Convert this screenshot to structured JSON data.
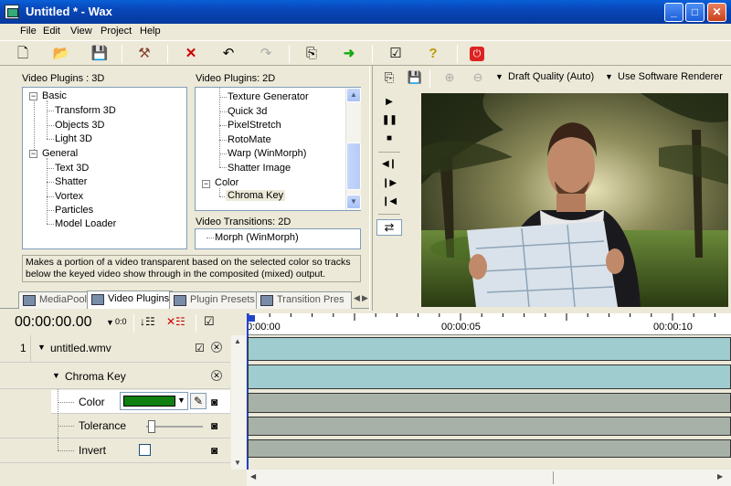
{
  "window": {
    "title": "Untitled * - Wax",
    "min": "_",
    "max": "□",
    "close": "✕"
  },
  "menu": [
    "File",
    "Edit",
    "View",
    "Project",
    "Help"
  ],
  "toolbar_icons": [
    "new-file",
    "open-folder",
    "save",
    "build",
    "delete",
    "undo",
    "redo",
    "export",
    "go-arrow",
    "properties",
    "help",
    "exit"
  ],
  "plugins3d": {
    "label": "Video Plugins : 3D",
    "groups": [
      {
        "name": "Basic",
        "items": [
          "Transform 3D",
          "Objects 3D",
          "Light 3D"
        ]
      },
      {
        "name": "General",
        "items": [
          "Text 3D",
          "Shatter",
          "Vortex",
          "Particles",
          "Model Loader"
        ]
      }
    ]
  },
  "plugins2d": {
    "label": "Video Plugins: 2D",
    "items": [
      "Texture Generator",
      "Quick 3d",
      "PixelStretch",
      "RotoMate",
      "Warp (WinMorph)",
      "Shatter Image"
    ],
    "group": "Color",
    "group_items": [
      "Chroma Key"
    ]
  },
  "transitions": {
    "label": "Video Transitions: 2D",
    "items": [
      "Morph (WinMorph)"
    ]
  },
  "description": "Makes a portion of a video transparent based on the selected color so tracks below the keyed video show through in the composited (mixed) output.",
  "tabs": [
    "MediaPool",
    "Video Plugins",
    "Plugin Presets",
    "Transition Pres"
  ],
  "preview_toolbar": {
    "quality": "Draft Quality (Auto)",
    "renderer": "Use Software Renderer"
  },
  "timeline": {
    "timecode": "00:00:00.00",
    "zoom": "0:0",
    "ruler": [
      "0:00:00",
      "00:00:05",
      "00:00:10"
    ],
    "track_number": "1",
    "track_name": "untitled.wmv",
    "effect": "Chroma Key",
    "params": [
      {
        "label": "Color",
        "color": "#0f7f0f"
      },
      {
        "label": "Tolerance",
        "value": 0.02
      },
      {
        "label": "Invert",
        "checked": false
      }
    ]
  }
}
